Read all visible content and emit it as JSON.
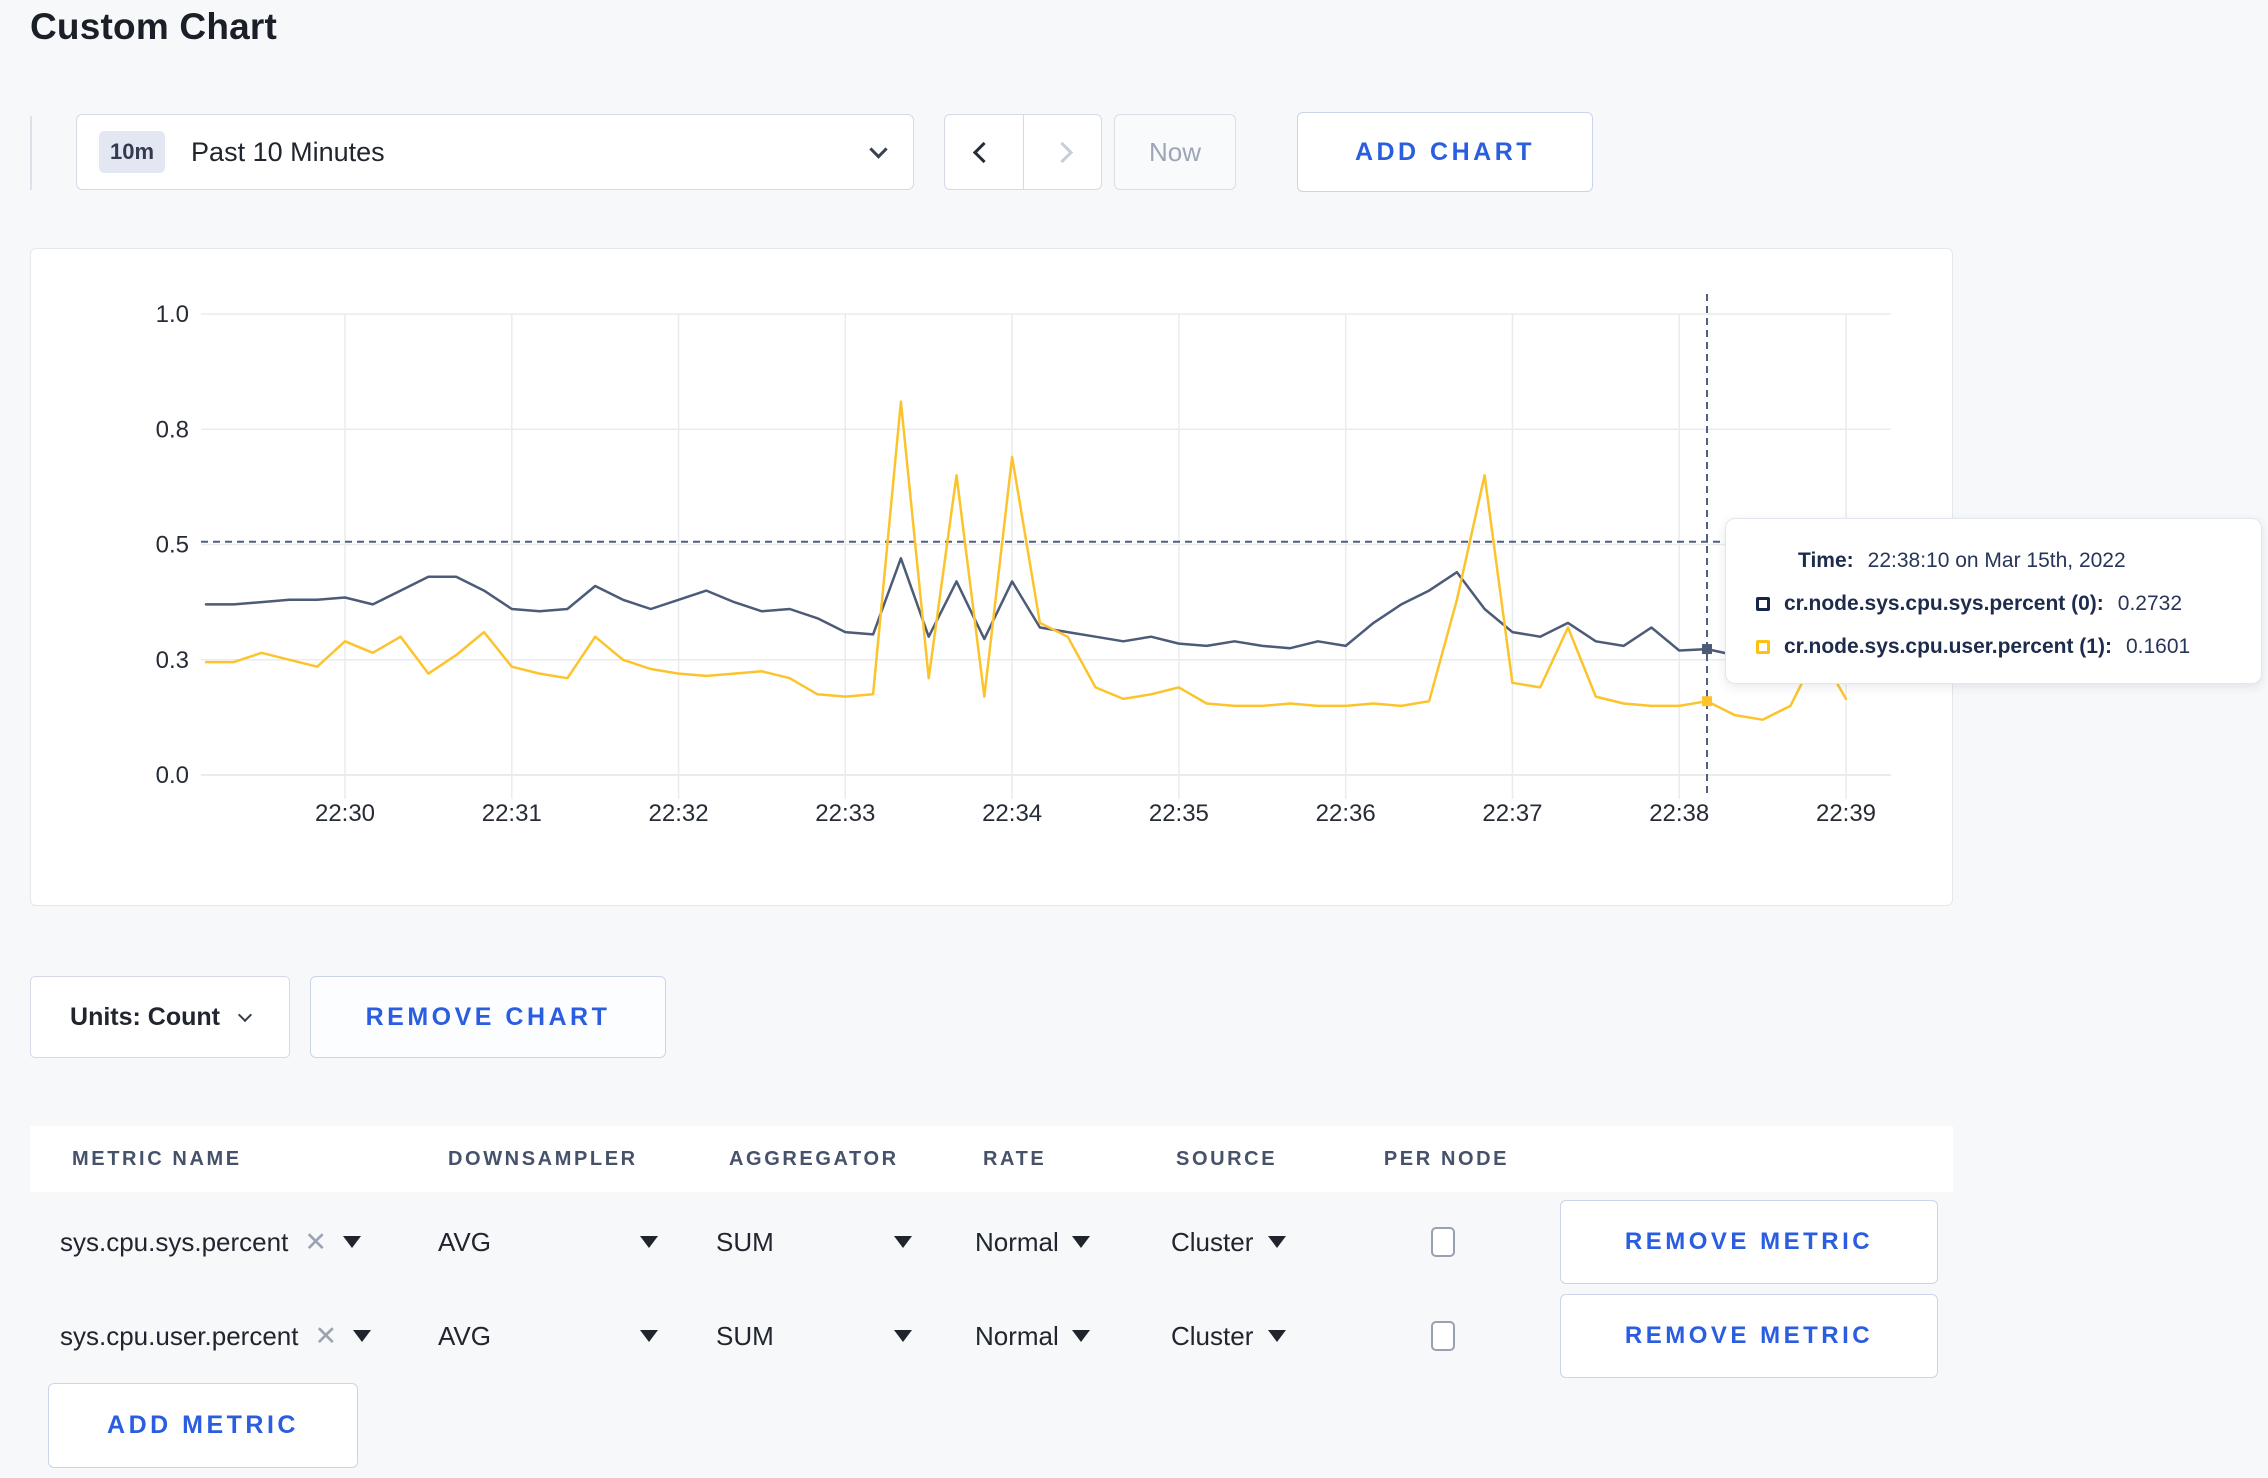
{
  "page": {
    "title": "Custom Chart"
  },
  "toolbar": {
    "time_window_badge": "10m",
    "time_window_label": "Past 10 Minutes",
    "now_label": "Now",
    "add_chart_label": "ADD CHART"
  },
  "chart_controls": {
    "units_label": "Units: Count",
    "remove_chart_label": "REMOVE CHART",
    "add_metric_label": "ADD METRIC"
  },
  "tooltip": {
    "time_label": "Time:",
    "time_value": "22:38:10 on Mar 15th, 2022",
    "series": [
      {
        "name": "cr.node.sys.cpu.sys.percent (0):",
        "value": "0.2732",
        "color": "#16254a"
      },
      {
        "name": "cr.node.sys.cpu.user.percent (1):",
        "value": "0.1601",
        "color": "#fdc013"
      }
    ]
  },
  "metrics_table": {
    "headers": [
      "METRIC NAME",
      "DOWNSAMPLER",
      "AGGREGATOR",
      "RATE",
      "SOURCE",
      "PER NODE"
    ],
    "remove_metric_label": "REMOVE METRIC",
    "rows": [
      {
        "metric": "sys.cpu.sys.percent",
        "downsampler": "AVG",
        "aggregator": "SUM",
        "rate": "Normal",
        "source": "Cluster",
        "per_node_checked": false
      },
      {
        "metric": "sys.cpu.user.percent",
        "downsampler": "AVG",
        "aggregator": "SUM",
        "rate": "Normal",
        "source": "Cluster",
        "per_node_checked": false
      }
    ]
  },
  "chart_data": {
    "type": "line",
    "title": "",
    "xlabel": "",
    "ylabel": "",
    "ylim": [
      0,
      1
    ],
    "grid": true,
    "x_ticks": [
      "22:30",
      "22:31",
      "22:32",
      "22:33",
      "22:34",
      "22:35",
      "22:36",
      "22:37",
      "22:38",
      "22:39"
    ],
    "x_tick_seconds": [
      0,
      60,
      120,
      180,
      240,
      300,
      360,
      420,
      480,
      540
    ],
    "y_ticks": {
      "values": [
        0,
        0.25,
        0.5,
        0.75,
        1
      ],
      "labels": [
        "0.0",
        "0.3",
        "0.5",
        "0.8",
        "1.0"
      ]
    },
    "sample_start_seconds": -50,
    "sample_interval_seconds": 10,
    "series": [
      {
        "name": "cr.node.sys.cpu.sys.percent",
        "color": "#4c5b77",
        "values": [
          0.37,
          0.37,
          0.375,
          0.38,
          0.38,
          0.385,
          0.37,
          0.4,
          0.43,
          0.43,
          0.4,
          0.36,
          0.355,
          0.36,
          0.41,
          0.38,
          0.36,
          0.38,
          0.4,
          0.375,
          0.355,
          0.36,
          0.34,
          0.31,
          0.305,
          0.47,
          0.3,
          0.42,
          0.295,
          0.42,
          0.32,
          0.31,
          0.3,
          0.29,
          0.3,
          0.285,
          0.28,
          0.29,
          0.28,
          0.275,
          0.29,
          0.28,
          0.33,
          0.37,
          0.4,
          0.44,
          0.36,
          0.31,
          0.3,
          0.33,
          0.29,
          0.28,
          0.32,
          0.27,
          0.2732,
          0.26,
          0.28,
          0.29,
          0.3,
          0.3
        ]
      },
      {
        "name": "cr.node.sys.cpu.user.percent",
        "color": "#fcc42c",
        "values": [
          0.245,
          0.245,
          0.265,
          0.25,
          0.235,
          0.29,
          0.265,
          0.3,
          0.22,
          0.26,
          0.31,
          0.235,
          0.22,
          0.21,
          0.3,
          0.25,
          0.23,
          0.22,
          0.215,
          0.22,
          0.225,
          0.21,
          0.175,
          0.17,
          0.175,
          0.81,
          0.21,
          0.65,
          0.17,
          0.69,
          0.33,
          0.3,
          0.19,
          0.165,
          0.175,
          0.19,
          0.155,
          0.15,
          0.15,
          0.155,
          0.15,
          0.15,
          0.155,
          0.15,
          0.16,
          0.38,
          0.65,
          0.2,
          0.19,
          0.32,
          0.17,
          0.155,
          0.15,
          0.15,
          0.1601,
          0.13,
          0.12,
          0.15,
          0.27,
          0.165
        ]
      }
    ],
    "crosshair": {
      "time": "22:38:10",
      "x_seconds": 490,
      "hline_value": 0.506,
      "marker_values": [
        0.2732,
        0.1601
      ],
      "color": "#4f5f7e"
    },
    "legend_position": "tooltip",
    "gridline_color": "#e9ebee",
    "tick_label_color": "#262c36"
  }
}
